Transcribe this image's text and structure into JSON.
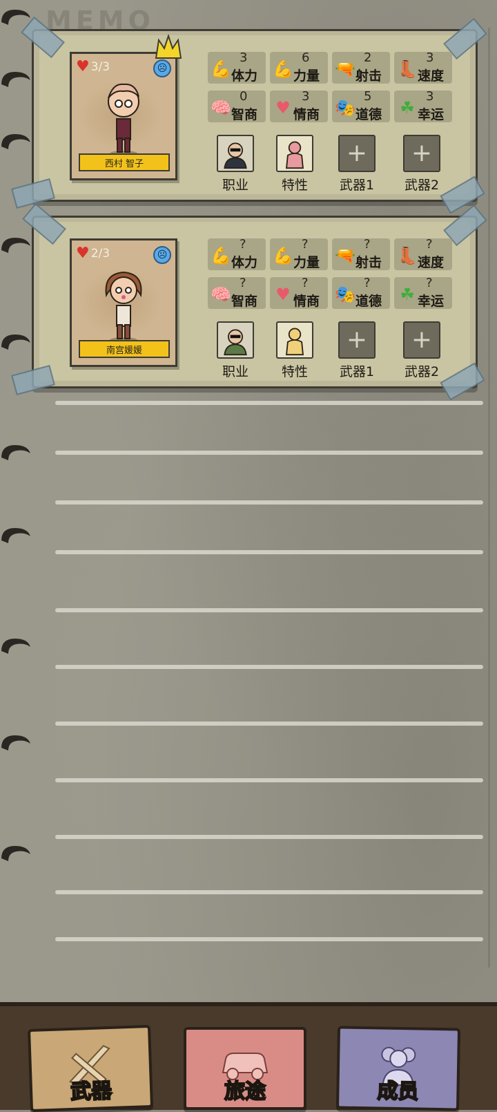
{
  "notebook": {
    "title": "MEMO"
  },
  "members": [
    {
      "name": "西村 智子",
      "hp": "3/3",
      "is_leader": true,
      "stats": [
        {
          "icon": "muscle-arm-icon",
          "label": "体力",
          "value": "3"
        },
        {
          "icon": "flexed-bicep-icon",
          "label": "力量",
          "value": "6"
        },
        {
          "icon": "revolver-icon",
          "label": "射击",
          "value": "2"
        },
        {
          "icon": "winged-boot-icon",
          "label": "速度",
          "value": "3"
        },
        {
          "icon": "brain-head-icon",
          "label": "智商",
          "value": "0"
        },
        {
          "icon": "heart-head-icon",
          "label": "情商",
          "value": "3"
        },
        {
          "icon": "comedy-mask-icon",
          "label": "道德",
          "value": "5"
        },
        {
          "icon": "clover-icon",
          "label": "幸运",
          "value": "3"
        }
      ],
      "slots": [
        {
          "label": "职业",
          "type": "job"
        },
        {
          "label": "特性",
          "type": "trait"
        },
        {
          "label": "武器1",
          "type": "empty"
        },
        {
          "label": "武器2",
          "type": "empty"
        }
      ]
    },
    {
      "name": "南宫媛媛",
      "hp": "2/3",
      "is_leader": false,
      "stats": [
        {
          "icon": "muscle-arm-icon",
          "label": "体力",
          "value": "?"
        },
        {
          "icon": "flexed-bicep-icon",
          "label": "力量",
          "value": "?"
        },
        {
          "icon": "revolver-icon",
          "label": "射击",
          "value": "?"
        },
        {
          "icon": "winged-boot-icon",
          "label": "速度",
          "value": "?"
        },
        {
          "icon": "brain-head-icon",
          "label": "智商",
          "value": "?"
        },
        {
          "icon": "heart-head-icon",
          "label": "情商",
          "value": "?"
        },
        {
          "icon": "comedy-mask-icon",
          "label": "道德",
          "value": "?"
        },
        {
          "icon": "clover-icon",
          "label": "幸运",
          "value": "?"
        }
      ],
      "slots": [
        {
          "label": "职业",
          "type": "job"
        },
        {
          "label": "特性",
          "type": "trait"
        },
        {
          "label": "武器1",
          "type": "empty"
        },
        {
          "label": "武器2",
          "type": "empty"
        }
      ]
    }
  ],
  "bottom_nav": [
    {
      "label": "武器",
      "icon": "weapons-icon",
      "color": "#c9a777"
    },
    {
      "label": "旅途",
      "icon": "car-icon",
      "color": "#d98c86"
    },
    {
      "label": "成员",
      "icon": "people-icon",
      "color": "#8d87b4"
    }
  ],
  "colors": {
    "nameplate": "#f2c21b",
    "card": "#c9c4a2",
    "heart": "#d9342b"
  }
}
